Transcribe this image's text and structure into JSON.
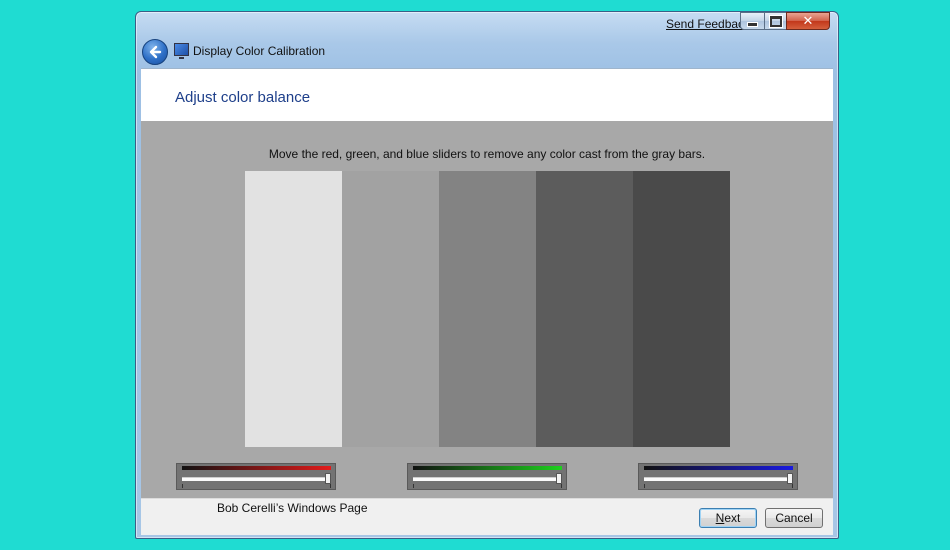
{
  "window": {
    "title": "Display Color Calibration",
    "send_feedback": "Send Feedback",
    "close_glyph": "✕"
  },
  "header": {
    "title": "Adjust color balance"
  },
  "main": {
    "instruction": "Move the red, green, and blue sliders to remove any color cast from the gray bars.",
    "bars": [
      "#e2e2e2",
      "#a2a2a2",
      "#838383",
      "#5c5c5c",
      "#4a4a4a"
    ],
    "sliders": [
      {
        "name": "red",
        "color": "#e31b1b",
        "value": 1.0
      },
      {
        "name": "green",
        "color": "#1ed11e",
        "value": 1.0
      },
      {
        "name": "blue",
        "color": "#1a1ae0",
        "value": 1.0
      }
    ]
  },
  "footer": {
    "credit": "Bob Cerelli’s Windows Page",
    "next_first": "N",
    "next_rest": "ext",
    "cancel": "Cancel"
  }
}
